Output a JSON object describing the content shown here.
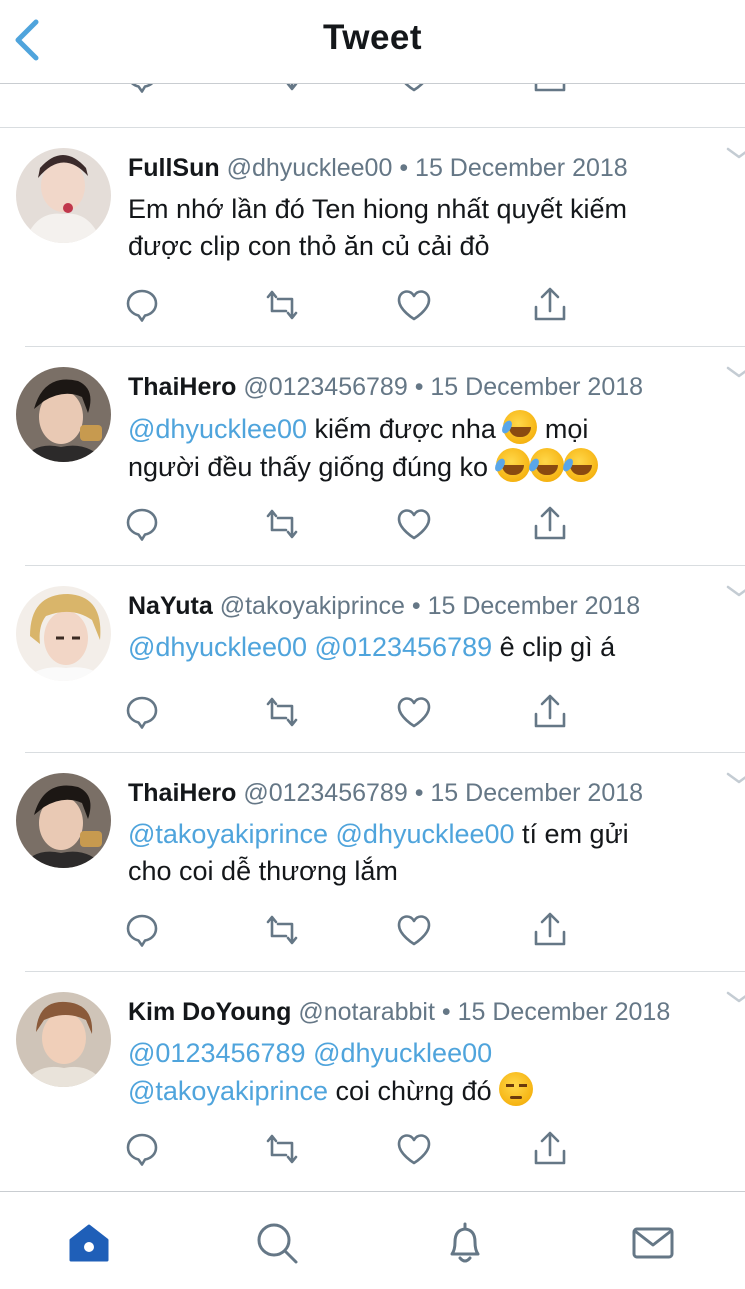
{
  "header": {
    "title": "Tweet"
  },
  "colors": {
    "accent": "#4fa4dc",
    "nav_icon_blue": "#1f5fb8",
    "muted": "#657786"
  },
  "tweets": [
    {
      "name": "FullSun",
      "handle": "@dhyucklee00",
      "separator": "•",
      "date": "15 December 2018",
      "avatar": "avatar-fullsun",
      "line1": [
        {
          "text": "Em nhớ lần đó Ten hiong nhất quyết kiếm"
        }
      ],
      "line2": [
        {
          "text": "được clip con thỏ ăn củ cải đỏ"
        }
      ]
    },
    {
      "name": "ThaiHero",
      "handle": "@0123456789",
      "separator": "•",
      "date": "15 December 2018",
      "avatar": "avatar-thaihero",
      "line1_mention": "@dhyucklee00",
      "line1_text": " kiếm được nha ",
      "line1_text2": " mọi",
      "line2_text": "người đều thấy giống đúng ko ",
      "emoji_lol": "rolling-on-floor-laughing"
    },
    {
      "name": "NaYuta",
      "handle": "@takoyakiprince",
      "separator": "•",
      "date": "15 December 2018",
      "avatar": "avatar-nayuta",
      "mention1": "@dhyucklee00",
      "mention2": "@0123456789",
      "text": " ê clip gì á"
    },
    {
      "name": "ThaiHero",
      "handle": "@0123456789",
      "separator": "•",
      "date": "15 December 2018",
      "avatar": "avatar-thaihero",
      "mention1": "@takoyakiprince",
      "mention2": "@dhyucklee00",
      "text1": " tí em gửi",
      "line2": "cho coi dễ thương lắm"
    },
    {
      "name": "Kim DoYoung",
      "handle": "@notarabbit",
      "separator": "•",
      "date": "15 December 2018",
      "avatar": "avatar-kimdoyoung",
      "mention1": "@0123456789",
      "mention2": "@dhyucklee00",
      "mention3": "@takoyakiprince",
      "text": " coi chừng đó ",
      "emoji": "unamused-face"
    }
  ],
  "tabs": [
    "home-icon",
    "search-icon",
    "notifications-icon",
    "messages-icon"
  ]
}
